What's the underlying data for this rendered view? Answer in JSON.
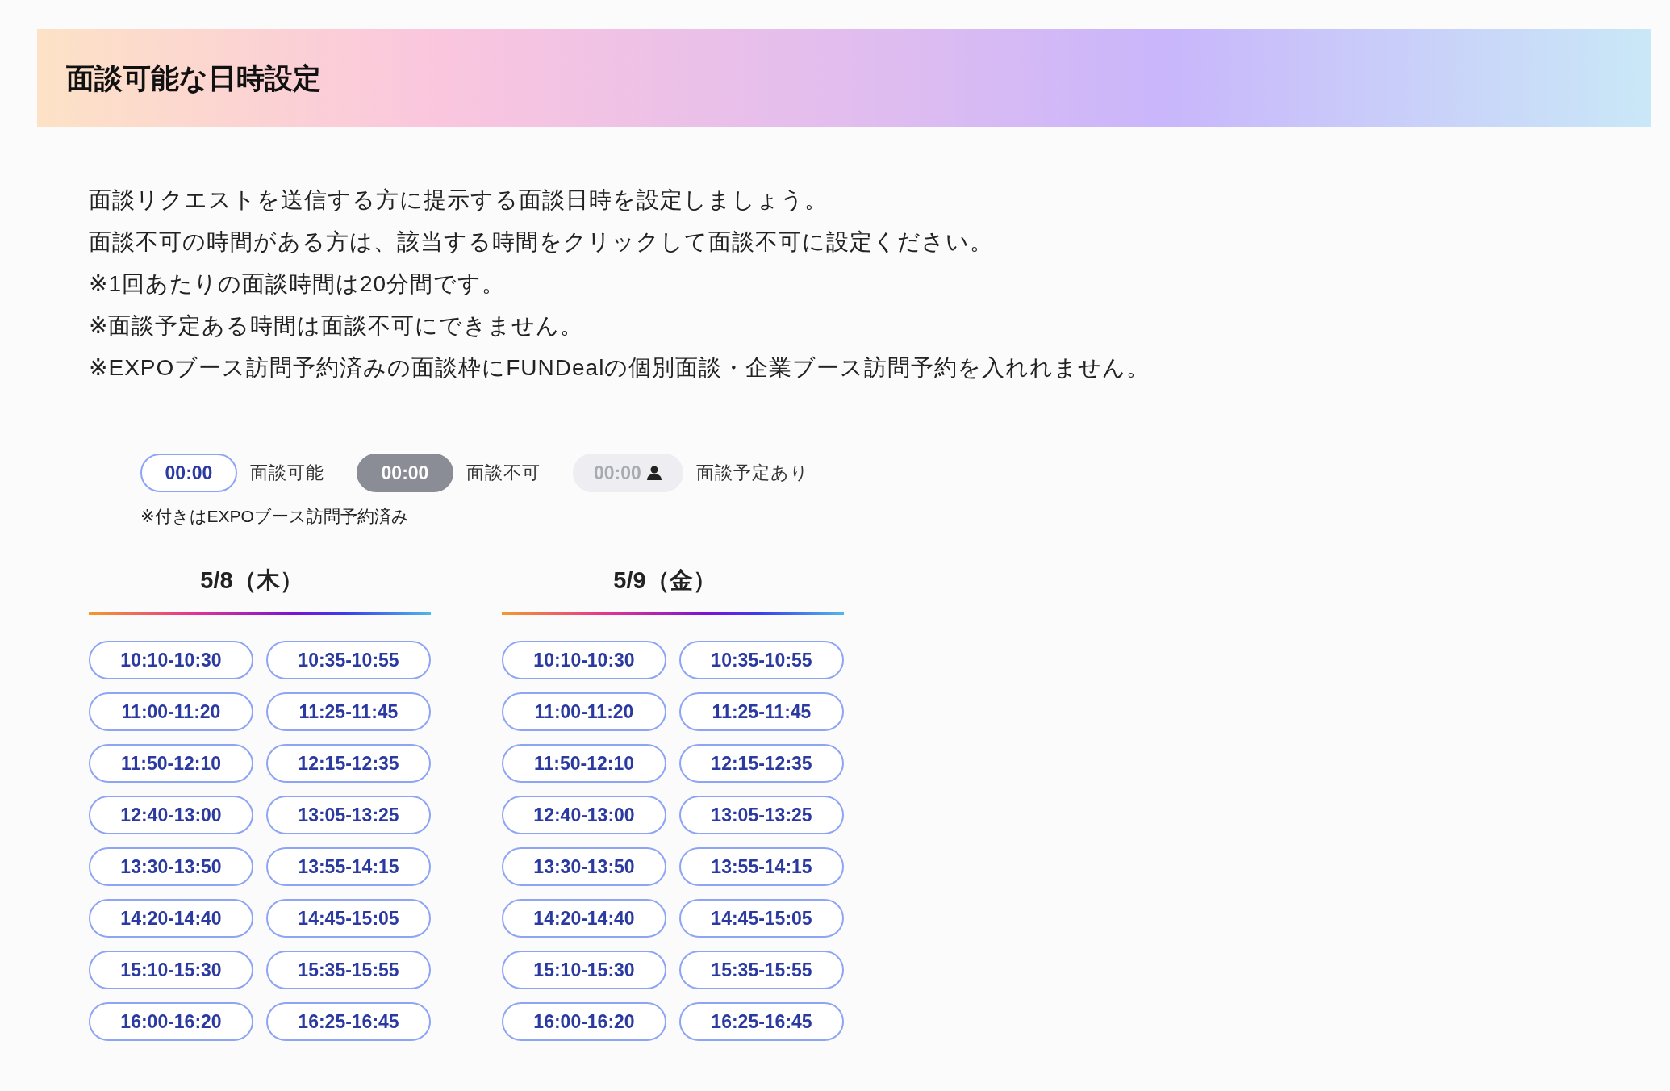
{
  "header": {
    "title": "面談可能な日時設定"
  },
  "description": [
    "面談リクエストを送信する方に提示する面談日時を設定しましょう。",
    "面談不可の時間がある方は、該当する時間をクリックして面談不可に設定ください。",
    "※1回あたりの面談時間は20分間です。",
    "※面談予定ある時間は面談不可にできません。",
    "※EXPOブース訪問予約済みの面談枠にFUNDealの個別面談・企業ブース訪問予約を入れれません。"
  ],
  "legend": [
    {
      "kind": "available",
      "sample": "00:00",
      "label": "面談可能"
    },
    {
      "kind": "unavailable",
      "sample": "00:00",
      "label": "面談不可"
    },
    {
      "kind": "booked",
      "sample": "00:00",
      "label": "面談予定あり"
    }
  ],
  "legend_note": "※付きはEXPOブース訪問予約済み",
  "days": [
    {
      "label": "5/8（木）",
      "slots": [
        {
          "time": "10:10-10:30",
          "kind": "available"
        },
        {
          "time": "10:35-10:55",
          "kind": "available"
        },
        {
          "time": "11:00-11:20",
          "kind": "available"
        },
        {
          "time": "11:25-11:45",
          "kind": "available"
        },
        {
          "time": "11:50-12:10",
          "kind": "available"
        },
        {
          "time": "12:15-12:35",
          "kind": "available"
        },
        {
          "time": "12:40-13:00",
          "kind": "available"
        },
        {
          "time": "13:05-13:25",
          "kind": "available"
        },
        {
          "time": "13:30-13:50",
          "kind": "available"
        },
        {
          "time": "13:55-14:15",
          "kind": "available"
        },
        {
          "time": "14:20-14:40",
          "kind": "available"
        },
        {
          "time": "14:45-15:05",
          "kind": "available"
        },
        {
          "time": "15:10-15:30",
          "kind": "available"
        },
        {
          "time": "15:35-15:55",
          "kind": "available"
        },
        {
          "time": "16:00-16:20",
          "kind": "available"
        },
        {
          "time": "16:25-16:45",
          "kind": "available"
        }
      ]
    },
    {
      "label": "5/9（金）",
      "slots": [
        {
          "time": "10:10-10:30",
          "kind": "available"
        },
        {
          "time": "10:35-10:55",
          "kind": "available"
        },
        {
          "time": "11:00-11:20",
          "kind": "available"
        },
        {
          "time": "11:25-11:45",
          "kind": "available"
        },
        {
          "time": "11:50-12:10",
          "kind": "available"
        },
        {
          "time": "12:15-12:35",
          "kind": "available"
        },
        {
          "time": "12:40-13:00",
          "kind": "available"
        },
        {
          "time": "13:05-13:25",
          "kind": "available"
        },
        {
          "time": "13:30-13:50",
          "kind": "available"
        },
        {
          "time": "13:55-14:15",
          "kind": "available"
        },
        {
          "time": "14:20-14:40",
          "kind": "available"
        },
        {
          "time": "14:45-15:05",
          "kind": "available"
        },
        {
          "time": "15:10-15:30",
          "kind": "available"
        },
        {
          "time": "15:35-15:55",
          "kind": "available"
        },
        {
          "time": "16:00-16:20",
          "kind": "available"
        },
        {
          "time": "16:25-16:45",
          "kind": "available"
        }
      ]
    }
  ]
}
